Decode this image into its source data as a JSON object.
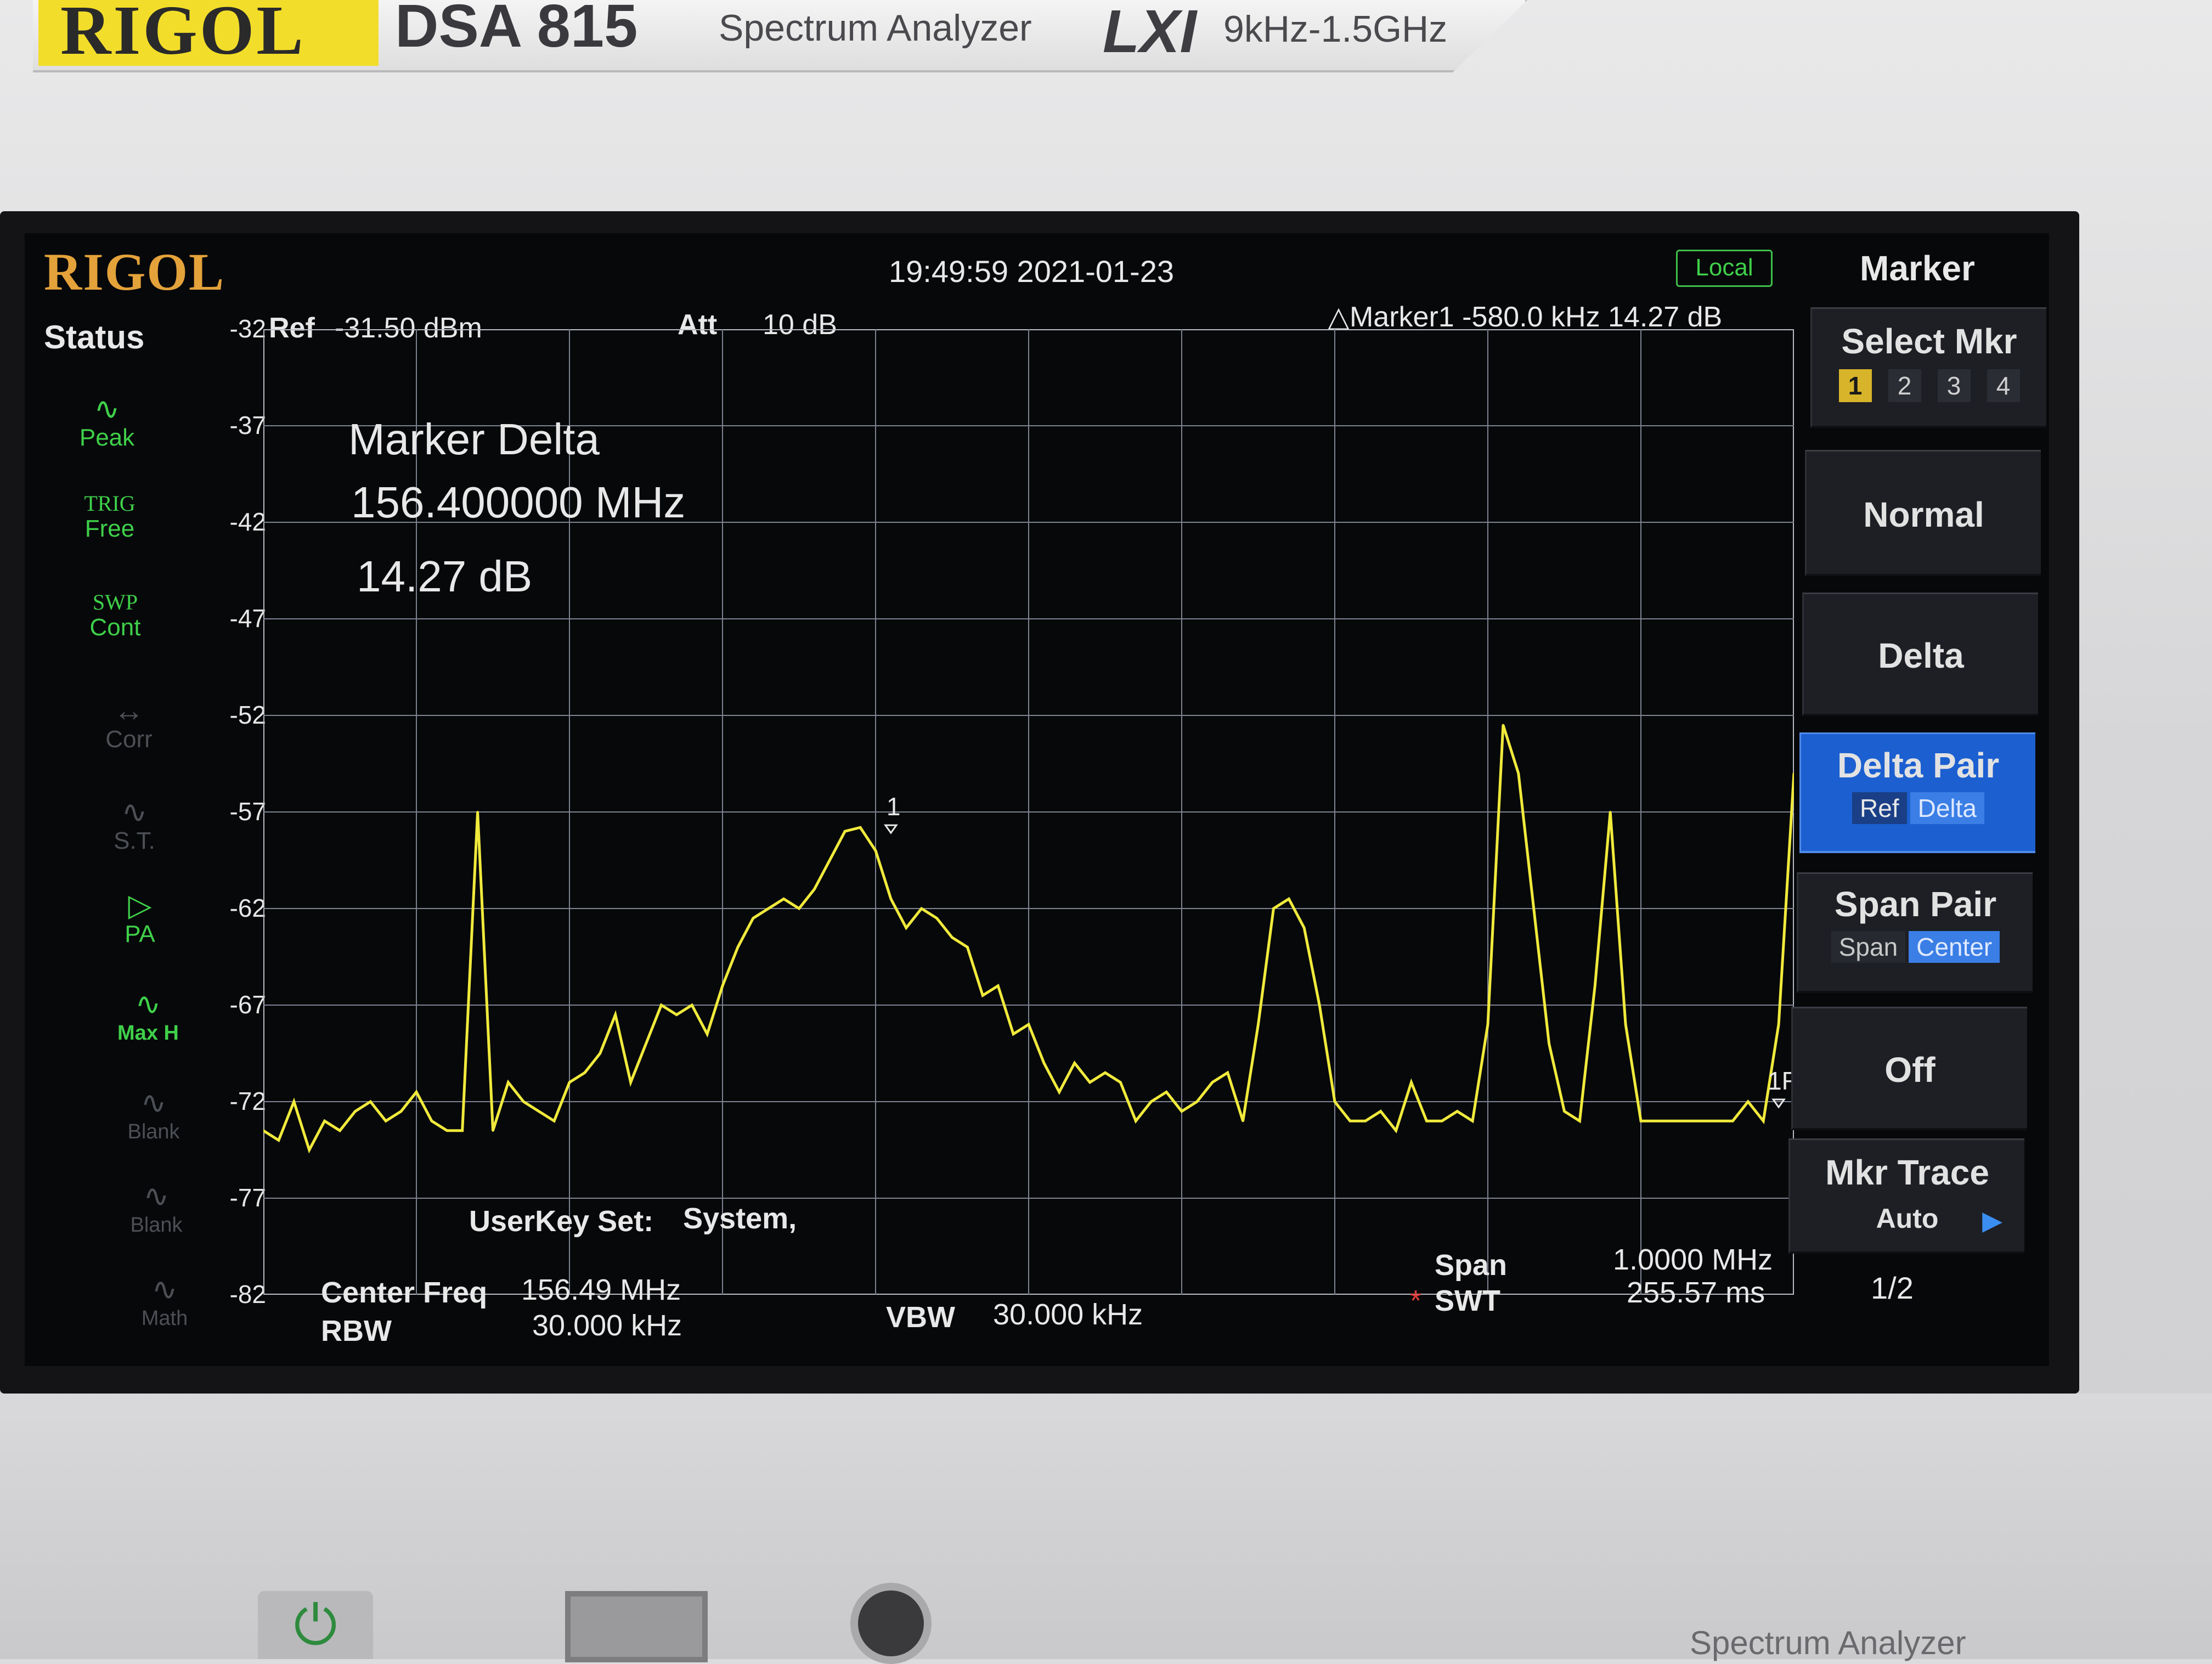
{
  "device": {
    "brand": "RIGOL",
    "model": "DSA 815",
    "product": "Spectrum Analyzer",
    "lxi": "LXI",
    "range": "9kHz-1.5GHz",
    "bottom_label": "Spectrum Analyzer"
  },
  "header": {
    "logo": "RIGOL",
    "datetime": "19:49:59 2021-01-23",
    "mode": "Local"
  },
  "status": {
    "title": "Status",
    "items": [
      {
        "top": "",
        "label": "Peak",
        "icon": "peak-wave-icon",
        "active": true
      },
      {
        "top": "TRIG",
        "label": "Free",
        "icon": "",
        "active": true
      },
      {
        "top": "SWP",
        "label": "Cont",
        "icon": "",
        "active": true
      },
      {
        "top": "",
        "label": "Corr",
        "icon": "corr-icon",
        "active": false
      },
      {
        "top": "",
        "label": "S.T.",
        "icon": "st-icon",
        "active": false
      },
      {
        "top": "",
        "label": "PA",
        "icon": "pa-amplifier-icon",
        "active": true
      },
      {
        "top": "",
        "label": "Max H",
        "icon": "maxhold-wave-icon",
        "active": true
      },
      {
        "top": "",
        "label": "Blank",
        "icon": "blank-wave-icon",
        "active": false
      },
      {
        "top": "",
        "label": "Blank",
        "icon": "blank-wave-icon",
        "active": false
      },
      {
        "top": "",
        "label": "Math",
        "icon": "math-wave-icon",
        "active": false
      }
    ]
  },
  "settings": {
    "ref_label": "Ref",
    "ref_value": "-31.50 dBm",
    "att_label": "Att",
    "att_value": "10 dB",
    "marker_readout": "△Marker1  -580.0 kHz  14.27 dB",
    "center_freq_label": "Center Freq",
    "center_freq_value": "156.49 MHz",
    "rbw_label": "RBW",
    "rbw_value": "30.000 kHz",
    "vbw_label": "VBW",
    "vbw_value": "30.000 kHz",
    "span_label": "Span",
    "span_value": "1.0000 MHz",
    "swt_star": "*",
    "swt_label": "SWT",
    "swt_value": "255.57 ms"
  },
  "overlay": {
    "title": "Marker Delta",
    "freq": "156.400000 MHz",
    "db": "14.27 dB",
    "userkey_label": "UserKey Set:",
    "userkey_value": "System,"
  },
  "chart_data": {
    "type": "line",
    "ylabel": "",
    "xlabel": "",
    "yticks": [
      "-32",
      "-37",
      "-42",
      "-47",
      "-52",
      "-57",
      "-62",
      "-67",
      "-72",
      "-77",
      "-82"
    ],
    "ylim": [
      -82,
      -32
    ],
    "xlim": [
      155.99,
      156.99
    ],
    "grid": true,
    "trace_color": "#f0ea3c",
    "series": [
      {
        "name": "",
        "x": [
          155.99,
          156.0,
          156.01,
          156.02,
          156.03,
          156.04,
          156.05,
          156.06,
          156.07,
          156.08,
          156.09,
          156.1,
          156.11,
          156.12,
          156.13,
          156.14,
          156.15,
          156.16,
          156.17,
          156.18,
          156.19,
          156.2,
          156.21,
          156.22,
          156.23,
          156.24,
          156.25,
          156.26,
          156.27,
          156.28,
          156.29,
          156.3,
          156.31,
          156.32,
          156.33,
          156.34,
          156.35,
          156.36,
          156.37,
          156.38,
          156.39,
          156.4,
          156.41,
          156.42,
          156.43,
          156.44,
          156.45,
          156.46,
          156.47,
          156.48,
          156.49,
          156.5,
          156.51,
          156.52,
          156.53,
          156.54,
          156.55,
          156.56,
          156.57,
          156.58,
          156.59,
          156.6,
          156.61,
          156.62,
          156.63,
          156.64,
          156.65,
          156.66,
          156.67,
          156.68,
          156.69,
          156.7,
          156.71,
          156.72,
          156.73,
          156.74,
          156.75,
          156.76,
          156.77,
          156.78,
          156.79,
          156.8,
          156.81,
          156.82,
          156.83,
          156.84,
          156.85,
          156.86,
          156.87,
          156.88,
          156.89,
          156.9,
          156.91,
          156.92,
          156.93,
          156.94,
          156.95,
          156.96,
          156.97,
          156.98,
          156.99
        ],
        "values": [
          -73.5,
          -74.0,
          -72.0,
          -74.5,
          -73.0,
          -73.5,
          -72.5,
          -72.0,
          -73.0,
          -72.5,
          -71.5,
          -73.0,
          -73.5,
          -73.5,
          -57.0,
          -73.5,
          -71.0,
          -72.0,
          -72.5,
          -73.0,
          -71.0,
          -70.5,
          -69.5,
          -67.5,
          -71.0,
          -69.0,
          -67.0,
          -67.5,
          -67.0,
          -68.5,
          -66.0,
          -64.0,
          -62.5,
          -62.0,
          -61.5,
          -62.0,
          -61.0,
          -59.5,
          -58.0,
          -57.8,
          -59.0,
          -61.5,
          -63.0,
          -62.0,
          -62.5,
          -63.5,
          -64.0,
          -66.5,
          -66.0,
          -68.5,
          -68.0,
          -70.0,
          -71.5,
          -70.0,
          -71.0,
          -70.5,
          -71.0,
          -73.0,
          -72.0,
          -71.5,
          -72.5,
          -72.0,
          -71.0,
          -70.5,
          -73.0,
          -68.0,
          -62.0,
          -61.5,
          -63.0,
          -67.0,
          -72.0,
          -73.0,
          -73.0,
          -72.5,
          -73.5,
          -71.0,
          -73.0,
          -73.0,
          -72.5,
          -73.0,
          -68.0,
          -52.5,
          -55.0,
          -62.0,
          -69.0,
          -72.5,
          -73.0,
          -66.0,
          -57.0,
          -68.0,
          -73.0,
          -73.0,
          -73.0,
          -73.0,
          -73.0,
          -73.0,
          -73.0,
          -72.0,
          -73.0,
          -68.0,
          -55.0
        ]
      }
    ],
    "markers": [
      {
        "label": "1",
        "x": 156.4,
        "y": -57.8
      },
      {
        "label": "1R",
        "x": 156.98,
        "y": -72.0
      }
    ]
  },
  "menu": {
    "title": "Marker",
    "select_mkr": "Select Mkr",
    "select_nums": [
      "1",
      "2",
      "3",
      "4"
    ],
    "normal": "Normal",
    "delta": "Delta",
    "delta_pair": "Delta Pair",
    "delta_pair_ref": "Ref",
    "delta_pair_delta": "Delta",
    "span_pair": "Span Pair",
    "span_pair_span": "Span",
    "span_pair_center": "Center",
    "off": "Off",
    "mkr_trace": "Mkr Trace",
    "mkr_trace_value": "Auto",
    "page": "1/2"
  }
}
